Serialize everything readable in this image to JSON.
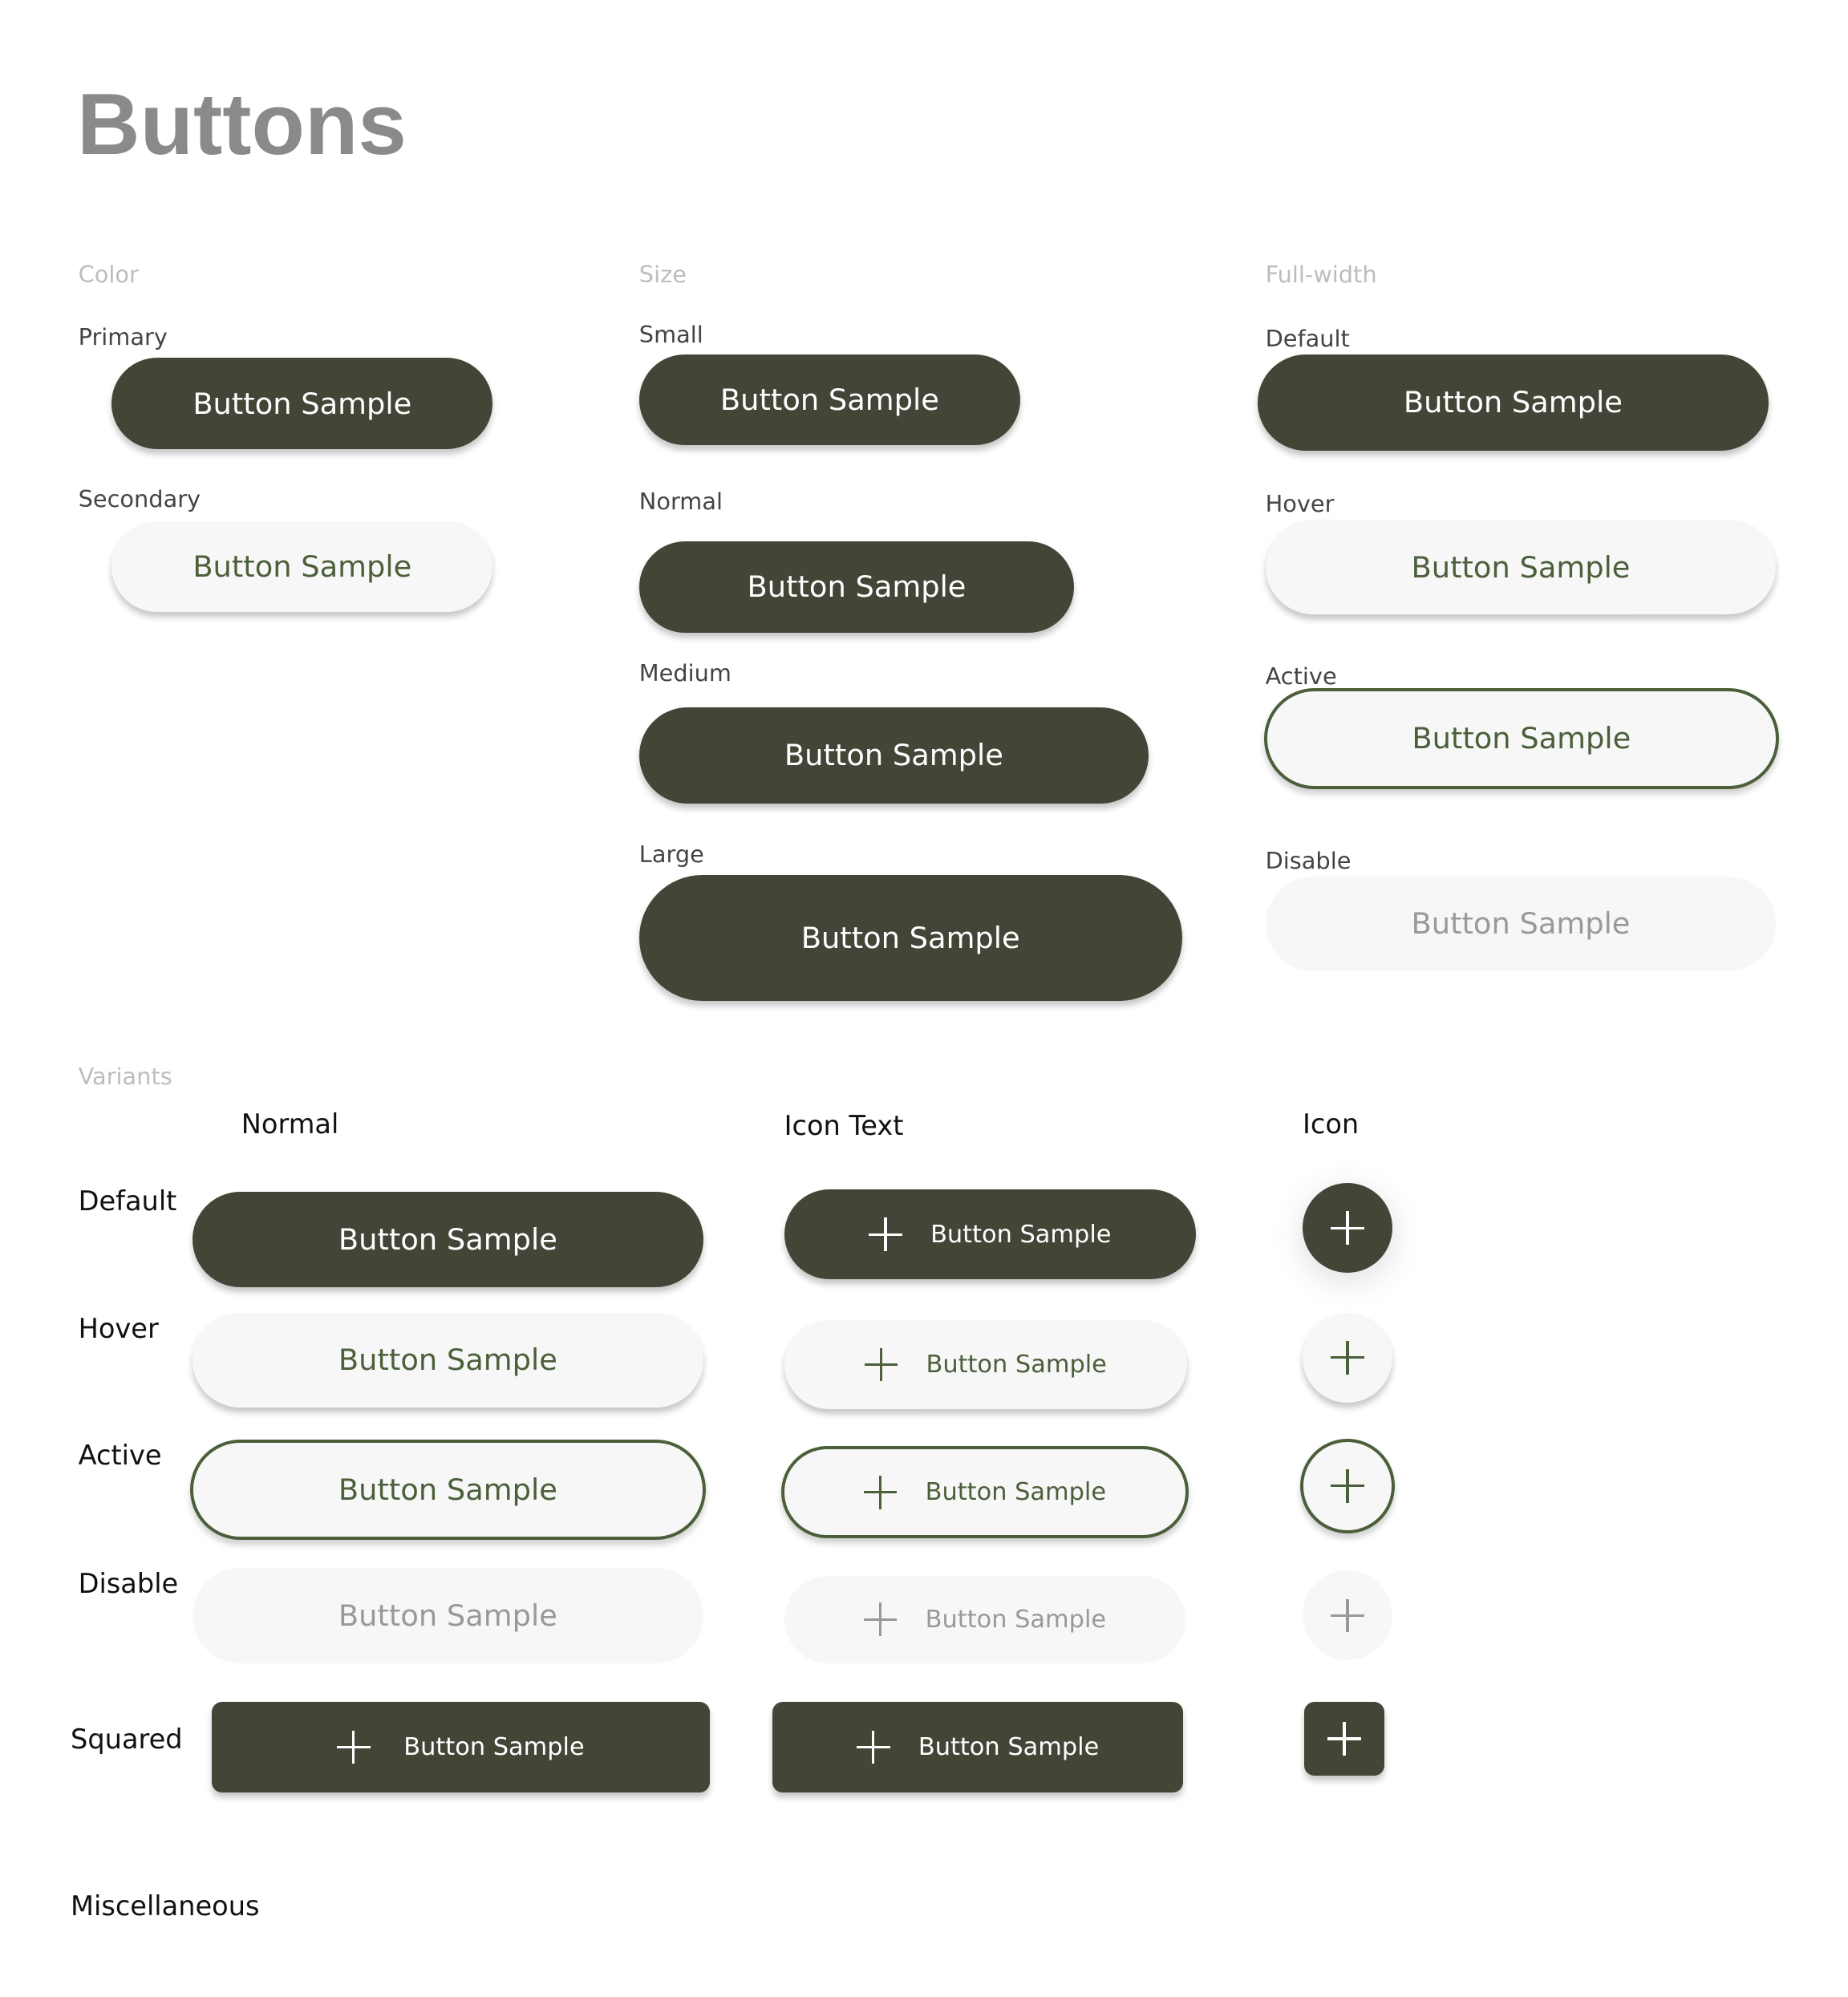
{
  "page_title": "Buttons",
  "button_label": "Button Sample",
  "colors": {
    "primary": "#434636",
    "accent_text": "#4b5f3a",
    "light_bg": "#f7f7f7",
    "disabled_text": "#999999"
  },
  "sections": {
    "color": {
      "title": "Color",
      "primary": "Primary",
      "secondary": "Secondary"
    },
    "size": {
      "title": "Size",
      "small": "Small",
      "normal": "Normal",
      "medium": "Medium",
      "large": "Large"
    },
    "full_width": {
      "title": "Full-width",
      "default": "Default",
      "hover": "Hover",
      "active": "Active",
      "disable": "Disable"
    },
    "variants": {
      "title": "Variants",
      "columns": {
        "normal": "Normal",
        "icon_text": "Icon Text",
        "icon": "Icon"
      },
      "rows": {
        "default": "Default",
        "hover": "Hover",
        "active": "Active",
        "disable": "Disable",
        "squared": "Squared"
      },
      "icon": "plus-icon"
    },
    "misc": {
      "title": "Miscellaneous"
    }
  }
}
